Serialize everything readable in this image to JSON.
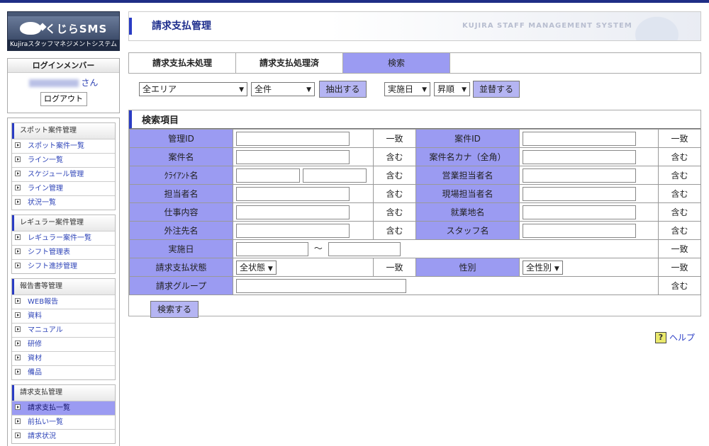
{
  "logo": {
    "text": "くじらSMS",
    "sub": "Kujiraスタッフマネジメントシステム"
  },
  "member": {
    "title": "ログインメンバー",
    "suffix": "さん",
    "logout": "ログアウト"
  },
  "menu": {
    "groups": [
      {
        "head": "スポット案件管理",
        "items": [
          "スポット案件一覧",
          "ライン一覧",
          "スケジュール管理",
          "ライン管理",
          "状況一覧"
        ]
      },
      {
        "head": "レギュラー案件管理",
        "items": [
          "レギュラー案件一覧",
          "シフト管理表",
          "シフト進捗管理"
        ]
      },
      {
        "head": "報告書等管理",
        "items": [
          "WEB報告",
          "資料",
          "マニュアル",
          "研修",
          "資材",
          "備品"
        ]
      },
      {
        "head": "請求支払管理",
        "items": [
          "請求支払一覧",
          "前払い一覧",
          "請求状況"
        ]
      }
    ]
  },
  "header": {
    "title": "請求支払管理",
    "system": "KUJIRA STAFF MANAGEMENT SYSTEM"
  },
  "tabs": [
    "請求支払未処理",
    "請求支払処理済",
    "検索"
  ],
  "filter": {
    "area": "全エリア",
    "count": "全件",
    "extract": "抽出する",
    "sort_field": "実施日",
    "sort_order": "昇順",
    "sort_button": "並替する"
  },
  "panel": {
    "title": "検索項目",
    "search_button": "検索する"
  },
  "fields": {
    "admin_id": "管理ID",
    "case_id": "案件ID",
    "case_name": "案件名",
    "case_name_kana": "案件名カナ（全角）",
    "client_name": "ｸﾗｲｱﾝﾄ名",
    "sales_rep": "営業担当者名",
    "rep": "担当者名",
    "site_rep": "現場担当者名",
    "job": "仕事内容",
    "work_place": "就業地名",
    "outsource": "外注先名",
    "staff": "スタッフ名",
    "date": "実施日",
    "tilde": "～",
    "status": "請求支払状態",
    "status_value": "全状態",
    "gender": "性別",
    "gender_value": "全性別",
    "group": "請求グループ"
  },
  "match": {
    "exact": "一致",
    "contains": "含む"
  },
  "help": "ヘルプ"
}
